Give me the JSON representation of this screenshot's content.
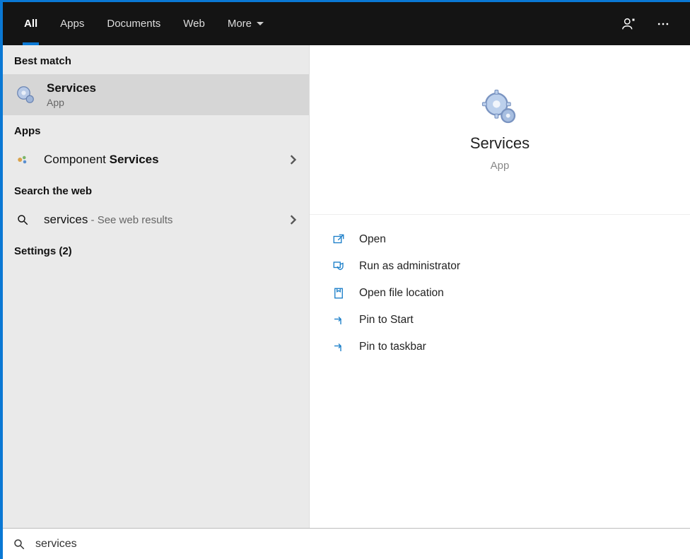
{
  "tabs": {
    "all": "All",
    "apps": "Apps",
    "documents": "Documents",
    "web": "Web",
    "more": "More"
  },
  "sections": {
    "best_match": "Best match",
    "apps": "Apps",
    "search_web": "Search the web",
    "settings": "Settings (2)"
  },
  "best_match": {
    "title": "Services",
    "subtitle": "App"
  },
  "apps_result": {
    "prefix": "Component ",
    "bold": "Services"
  },
  "web_result": {
    "query": "services",
    "hint": " - See web results"
  },
  "detail": {
    "title": "Services",
    "subtitle": "App"
  },
  "actions": {
    "open": "Open",
    "run_admin": "Run as administrator",
    "open_loc": "Open file location",
    "pin_start": "Pin to Start",
    "pin_taskbar": "Pin to taskbar"
  },
  "search": {
    "value": "services"
  }
}
